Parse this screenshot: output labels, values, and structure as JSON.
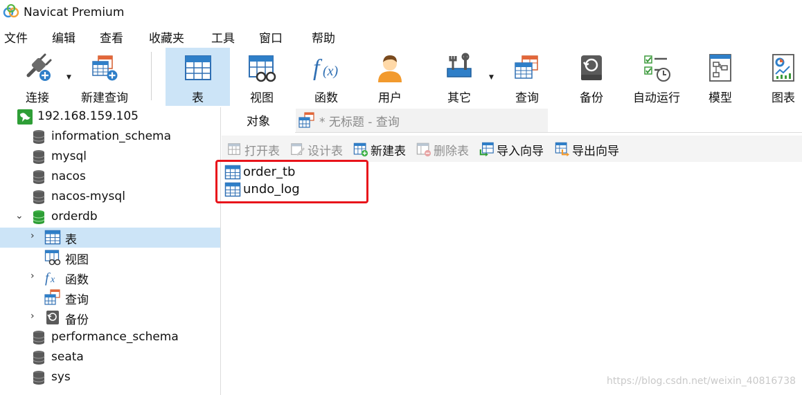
{
  "window": {
    "title": "Navicat Premium"
  },
  "menu": [
    "文件",
    "编辑",
    "查看",
    "收藏夹",
    "工具",
    "窗口",
    "帮助"
  ],
  "toolbar": [
    {
      "label": "连接",
      "icon": "plug-icon",
      "active": false,
      "dropdown": true
    },
    {
      "label": "新建查询",
      "icon": "new-query-icon",
      "active": false,
      "dropdown": false
    },
    {
      "label": "表",
      "icon": "table-icon",
      "active": true,
      "dropdown": false
    },
    {
      "label": "视图",
      "icon": "view-icon",
      "active": false,
      "dropdown": false
    },
    {
      "label": "函数",
      "icon": "function-icon",
      "active": false,
      "dropdown": false
    },
    {
      "label": "用户",
      "icon": "user-icon",
      "active": false,
      "dropdown": false
    },
    {
      "label": "其它",
      "icon": "tools-icon",
      "active": false,
      "dropdown": true
    },
    {
      "label": "查询",
      "icon": "query-icon",
      "active": false,
      "dropdown": false
    },
    {
      "label": "备份",
      "icon": "backup-icon",
      "active": false,
      "dropdown": false
    },
    {
      "label": "自动运行",
      "icon": "auto-run-icon",
      "active": false,
      "dropdown": false
    },
    {
      "label": "模型",
      "icon": "model-icon",
      "active": false,
      "dropdown": false
    },
    {
      "label": "图表",
      "icon": "chart-icon",
      "active": false,
      "dropdown": false
    }
  ],
  "sidebar": {
    "items": [
      {
        "label": "192.168.159.105",
        "icon": "connection-icon",
        "expanded": true
      },
      {
        "label": "information_schema",
        "icon": "database-icon"
      },
      {
        "label": "mysql",
        "icon": "database-icon"
      },
      {
        "label": "nacos",
        "icon": "database-icon"
      },
      {
        "label": "nacos-mysql",
        "icon": "database-icon"
      },
      {
        "label": "orderdb",
        "icon": "database-open-icon",
        "expanded": true
      },
      {
        "label": "表",
        "icon": "table-icon",
        "selected": true
      },
      {
        "label": "视图",
        "icon": "view-icon"
      },
      {
        "label": "函数",
        "icon": "function-icon"
      },
      {
        "label": "查询",
        "icon": "query-icon"
      },
      {
        "label": "备份",
        "icon": "backup-icon"
      },
      {
        "label": "performance_schema",
        "icon": "database-icon"
      },
      {
        "label": "seata",
        "icon": "database-icon"
      },
      {
        "label": "sys",
        "icon": "database-icon"
      }
    ]
  },
  "tabs": {
    "objects": "对象",
    "query": "* 无标题 - 查询"
  },
  "object_toolbar": [
    {
      "label": "打开表",
      "icon": "open-table-icon",
      "enabled": false
    },
    {
      "label": "设计表",
      "icon": "design-table-icon",
      "enabled": false
    },
    {
      "label": "新建表",
      "icon": "new-table-icon",
      "enabled": true
    },
    {
      "label": "删除表",
      "icon": "delete-table-icon",
      "enabled": false
    },
    {
      "label": "导入向导",
      "icon": "import-wizard-icon",
      "enabled": true
    },
    {
      "label": "导出向导",
      "icon": "export-wizard-icon",
      "enabled": true
    }
  ],
  "objects": [
    "order_tb",
    "undo_log"
  ],
  "watermark": "https://blog.csdn.net/weixin_40816738",
  "colors": {
    "selection": "#cce4f7",
    "highlight": "#e8141b",
    "accent": "#2f6fb3"
  }
}
